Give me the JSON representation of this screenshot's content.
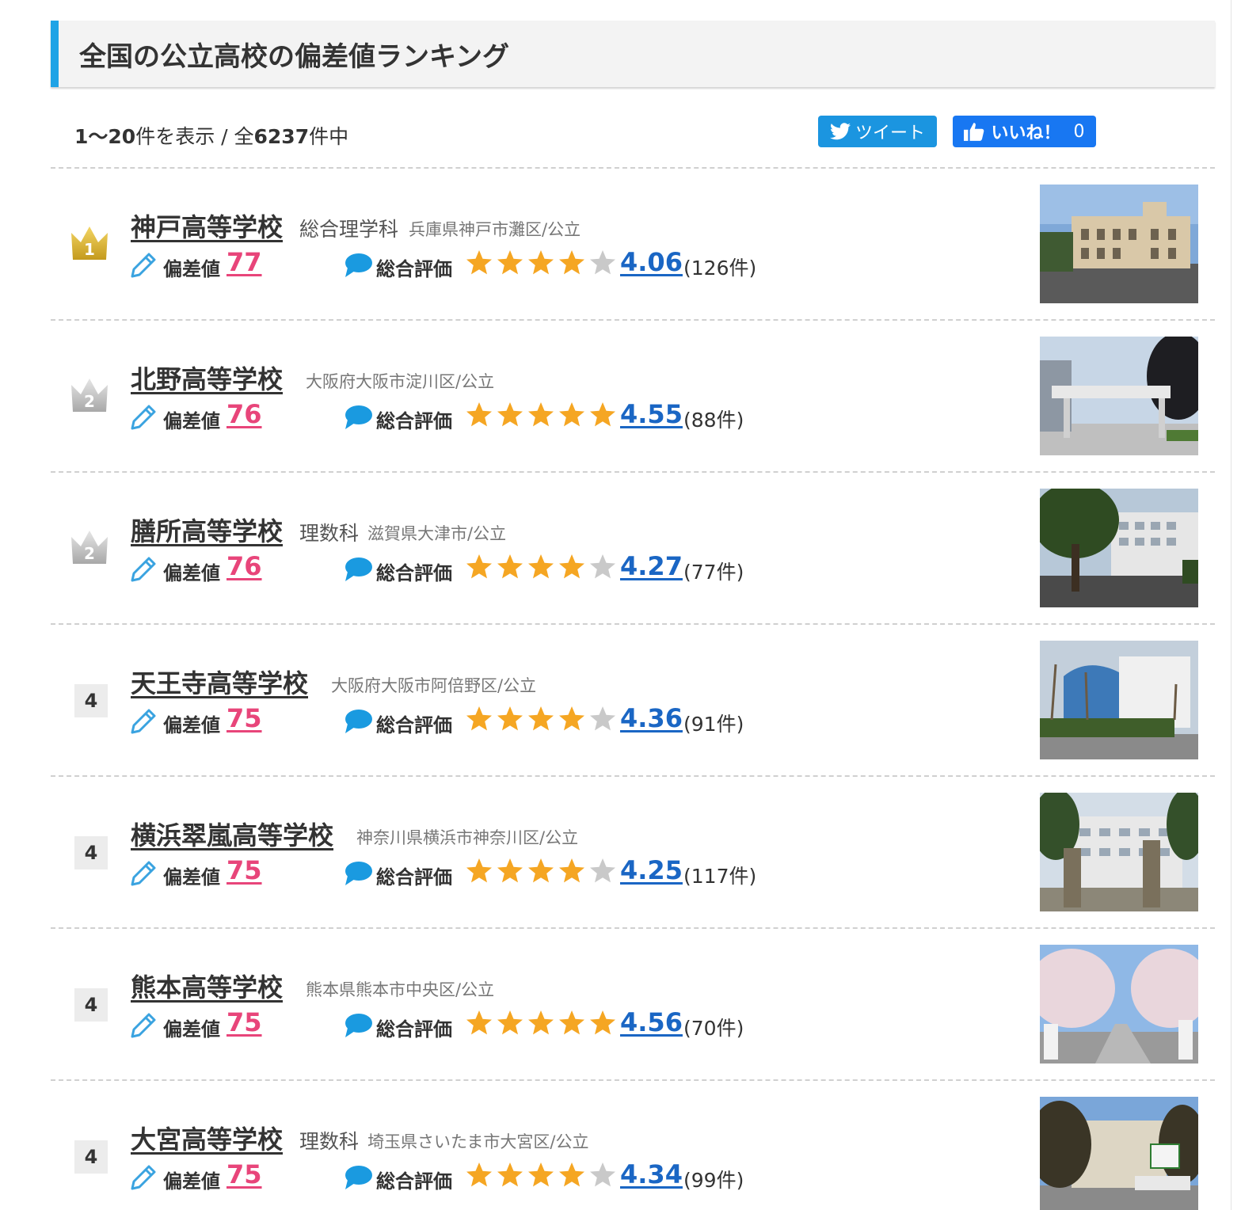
{
  "header": {
    "title": "全国の公立高校の偏差値ランキング"
  },
  "summary": {
    "range": "1～20",
    "shown_suffix": "件を表示 / 全",
    "total": "6237",
    "total_suffix": "件中"
  },
  "share": {
    "tweet_label": "ツイート",
    "like_label": "いいね！",
    "like_count": "0"
  },
  "labels": {
    "hensachi": "偏差値",
    "rating": "総合評価"
  },
  "colors": {
    "accent": "#1fa3e6",
    "hensachi": "#e8457a",
    "rating": "#1a66c4",
    "star": "#f5a623",
    "star_empty": "#c9c9c9"
  },
  "schools": [
    {
      "rank": "1",
      "rank_style": "gold",
      "name": "神戸高等学校",
      "dept": "総合理学科",
      "location": "兵庫県神戸市灘区/公立",
      "hensachi": "77",
      "rating": "4.06",
      "rating_stars": 4,
      "reviews": "(126件)"
    },
    {
      "rank": "2",
      "rank_style": "silver",
      "name": "北野高等学校",
      "dept": "",
      "location": "大阪府大阪市淀川区/公立",
      "hensachi": "76",
      "rating": "4.55",
      "rating_stars": 5,
      "reviews": "(88件)"
    },
    {
      "rank": "2",
      "rank_style": "silver",
      "name": "膳所高等学校",
      "dept": "理数科",
      "location": "滋賀県大津市/公立",
      "hensachi": "76",
      "rating": "4.27",
      "rating_stars": 4,
      "reviews": "(77件)"
    },
    {
      "rank": "4",
      "rank_style": "plain",
      "name": "天王寺高等学校",
      "dept": "",
      "location": "大阪府大阪市阿倍野区/公立",
      "hensachi": "75",
      "rating": "4.36",
      "rating_stars": 4,
      "reviews": "(91件)"
    },
    {
      "rank": "4",
      "rank_style": "plain",
      "name": "横浜翠嵐高等学校",
      "dept": "",
      "location": "神奈川県横浜市神奈川区/公立",
      "hensachi": "75",
      "rating": "4.25",
      "rating_stars": 4,
      "reviews": "(117件)"
    },
    {
      "rank": "4",
      "rank_style": "plain",
      "name": "熊本高等学校",
      "dept": "",
      "location": "熊本県熊本市中央区/公立",
      "hensachi": "75",
      "rating": "4.56",
      "rating_stars": 5,
      "reviews": "(70件)"
    },
    {
      "rank": "4",
      "rank_style": "plain",
      "name": "大宮高等学校",
      "dept": "理数科",
      "location": "埼玉県さいたま市大宮区/公立",
      "hensachi": "75",
      "rating": "4.34",
      "rating_stars": 4,
      "reviews": "(99件)"
    }
  ]
}
